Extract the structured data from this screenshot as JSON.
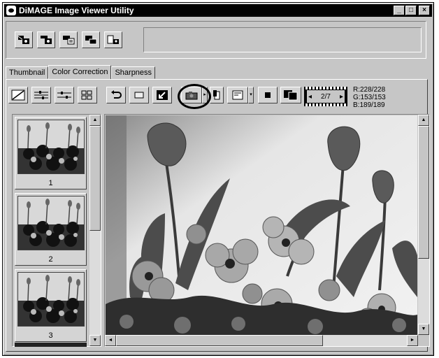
{
  "window": {
    "title": "DiMAGE Image Viewer Utility",
    "controls": {
      "minimize": "_",
      "maximize": "□",
      "close": "×"
    }
  },
  "top_toolbar": {
    "buttons": [
      {
        "icon": "import-camera-icon"
      },
      {
        "icon": "save-camera-icon"
      },
      {
        "icon": "camera-settings-icon"
      },
      {
        "icon": "camera-transfer-icon"
      },
      {
        "icon": "camera-file-icon"
      }
    ]
  },
  "tabs": [
    {
      "label": "Thumbnail",
      "active": false
    },
    {
      "label": "Color Correction",
      "active": true
    },
    {
      "label": "Sharpness",
      "active": false
    }
  ],
  "correction_toolbar": {
    "buttons": [
      {
        "icon": "tone-curve-icon"
      },
      {
        "icon": "color-balance-icon"
      },
      {
        "icon": "brightness-contrast-icon"
      },
      {
        "icon": "variations-icon"
      },
      {
        "icon": "undo-icon"
      },
      {
        "icon": "reset-icon"
      },
      {
        "icon": "fit-window-icon"
      },
      {
        "icon": "snapshot-camera-icon"
      },
      {
        "icon": "copy-icon"
      },
      {
        "icon": "display-mode-icon"
      },
      {
        "icon": "solid-view-icon"
      },
      {
        "icon": "compare-view-icon"
      }
    ]
  },
  "navigator": {
    "counter": "2/7",
    "prev": "◂",
    "next": "▸"
  },
  "rgb_readout": {
    "r": "R:228/228",
    "g": "G:153/153",
    "b": "B:189/189"
  },
  "thumbnails": [
    {
      "number": "1"
    },
    {
      "number": "2"
    },
    {
      "number": "3"
    }
  ],
  "scroll_glyphs": {
    "up": "▲",
    "down": "▼",
    "left": "◄",
    "right": "►"
  }
}
